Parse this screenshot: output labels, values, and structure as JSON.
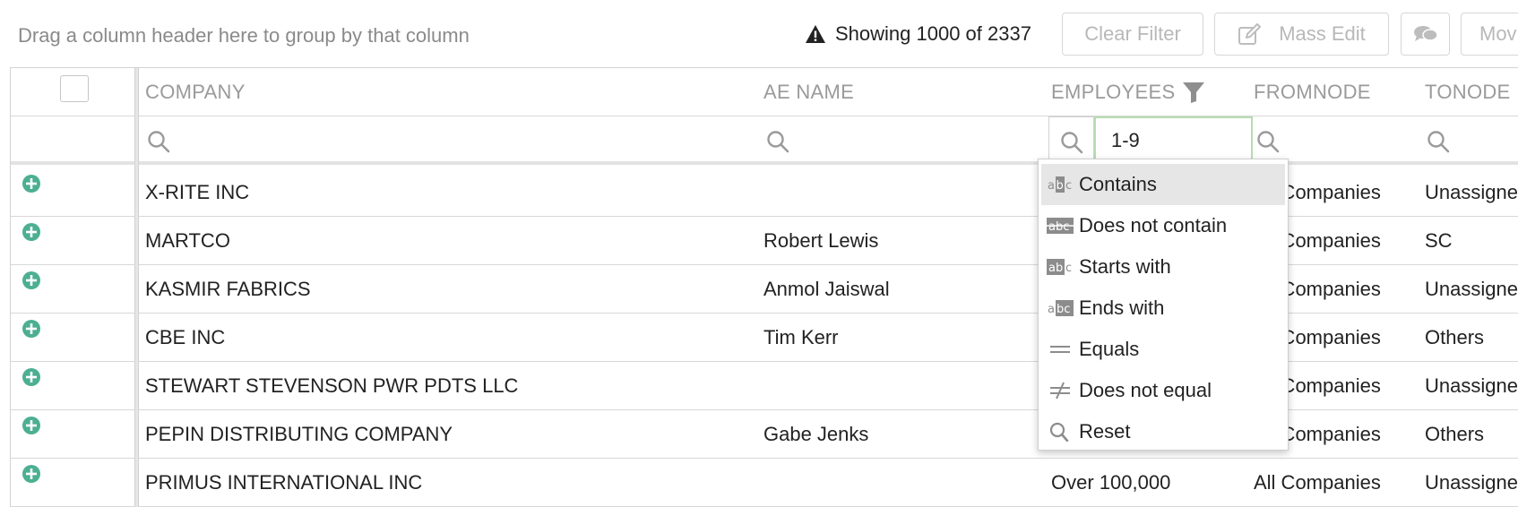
{
  "toolbar": {
    "group_hint": "Drag a column header here to group by that column",
    "showing_text": "Showing 1000 of 2337",
    "clear_filter_label": "Clear Filter",
    "mass_edit_label": "Mass Edit",
    "move_label": "Mov"
  },
  "columns": {
    "company": "COMPANY",
    "ae_name": "AE NAME",
    "employees": "EMPLOYEES",
    "fromnode": "FROMNODE",
    "tonode": "TONODE"
  },
  "filters": {
    "employees_value": "1-9"
  },
  "rows": [
    {
      "company": "X-RITE INC",
      "ae_name": "",
      "employees": "",
      "fromnode": "All Companies",
      "tonode": "Unassigned"
    },
    {
      "company": "MARTCO",
      "ae_name": "Robert Lewis",
      "employees": "",
      "fromnode": "All Companies",
      "tonode": "SC"
    },
    {
      "company": "KASMIR FABRICS",
      "ae_name": "Anmol Jaiswal",
      "employees": "",
      "fromnode": "All Companies",
      "tonode": "Unassigned"
    },
    {
      "company": "CBE INC",
      "ae_name": "Tim Kerr",
      "employees": "",
      "fromnode": "All Companies",
      "tonode": "Others"
    },
    {
      "company": "STEWART STEVENSON PWR PDTS LLC",
      "ae_name": "",
      "employees": "",
      "fromnode": "All Companies",
      "tonode": "Unassigned"
    },
    {
      "company": "PEPIN DISTRIBUTING COMPANY",
      "ae_name": "Gabe Jenks",
      "employees": "",
      "fromnode": "All Companies",
      "tonode": "Others"
    },
    {
      "company": "PRIMUS INTERNATIONAL INC",
      "ae_name": "",
      "employees": "Over 100,000",
      "fromnode": "All Companies",
      "tonode": "Unassigned"
    }
  ],
  "filter_menu": {
    "items": [
      "Contains",
      "Does not contain",
      "Starts with",
      "Ends with",
      "Equals",
      "Does not equal",
      "Reset"
    ],
    "selected_index": 0
  },
  "colors": {
    "add_icon": "#4caf91",
    "filter_focus_border": "#b6dcb1",
    "menu_highlight": "#e6e6e6"
  }
}
